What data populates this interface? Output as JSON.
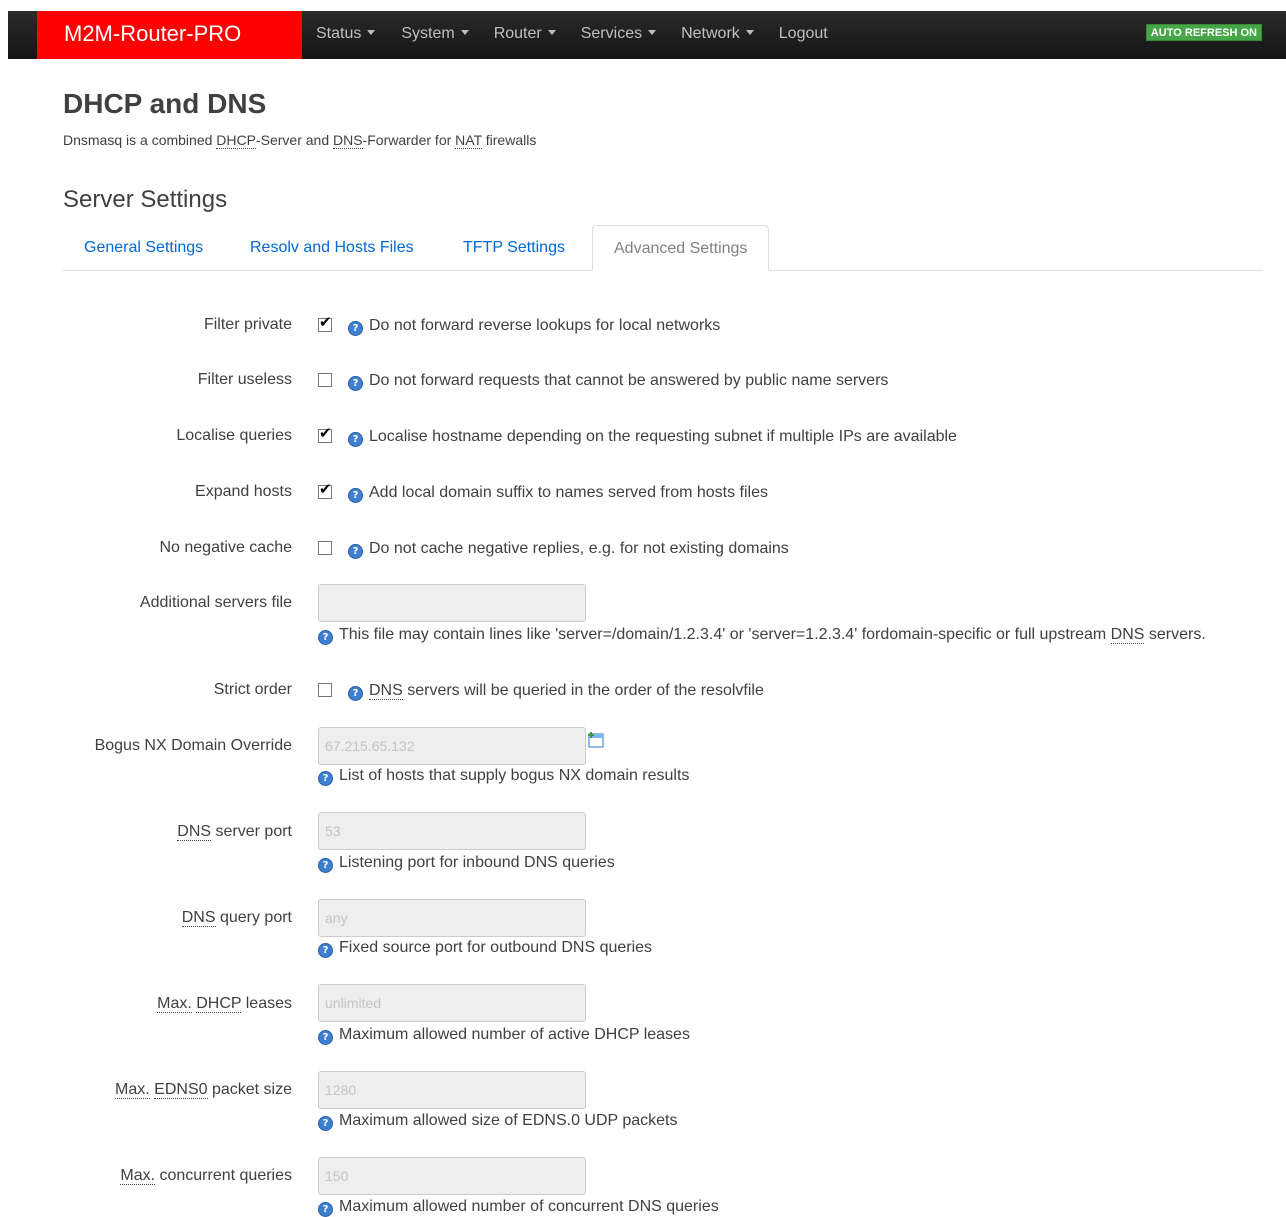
{
  "nav": {
    "brand": "M2M-Router-PRO",
    "menu": [
      {
        "label": "Status",
        "dropdown": true
      },
      {
        "label": "System",
        "dropdown": true
      },
      {
        "label": "Router",
        "dropdown": true
      },
      {
        "label": "Services",
        "dropdown": true
      },
      {
        "label": "Network",
        "dropdown": true
      },
      {
        "label": "Logout",
        "dropdown": false
      }
    ],
    "autorefresh": "AUTO REFRESH ON"
  },
  "page": {
    "title": "DHCP and DNS",
    "desc_parts": [
      "Dnsmasq is a combined ",
      "DHCP",
      "-Server and ",
      "DNS",
      "-Forwarder for ",
      "NAT",
      " firewalls"
    ]
  },
  "section": {
    "title": "Server Settings",
    "tabs": [
      "General Settings",
      "Resolv and Hosts Files",
      "TFTP Settings",
      "Advanced Settings"
    ],
    "active_tab": "Advanced Settings"
  },
  "fields": {
    "filter_private": {
      "label": "Filter private",
      "checked": true,
      "help": "Do not forward reverse lookups for local networks"
    },
    "filter_useless": {
      "label": "Filter useless",
      "checked": false,
      "help": "Do not forward requests that cannot be answered by public name servers"
    },
    "localise_queries": {
      "label": "Localise queries",
      "checked": true,
      "help": "Localise hostname depending on the requesting subnet if multiple IPs are available"
    },
    "expand_hosts": {
      "label": "Expand hosts",
      "checked": true,
      "help": "Add local domain suffix to names served from hosts files"
    },
    "no_negative_cache": {
      "label": "No negative cache",
      "checked": false,
      "help": "Do not cache negative replies, e.g. for not existing domains"
    },
    "additional_servers_file": {
      "label": "Additional servers file",
      "value": "",
      "placeholder": "",
      "help_parts": [
        "This file may contain lines like 'server=/domain/1.2.3.4' or 'server=1.2.3.4' fordomain-specific or full upstream ",
        "DNS",
        " servers."
      ]
    },
    "strict_order": {
      "label": "Strict order",
      "checked": false,
      "help_parts": [
        "DNS",
        " servers will be queried in the order of the resolvfile"
      ]
    },
    "bogus_nx": {
      "label": "Bogus NX Domain Override",
      "placeholder": "67.215.65.132",
      "help": "List of hosts that supply bogus NX domain results"
    },
    "dns_server_port": {
      "label_parts": [
        "DNS",
        " server port"
      ],
      "placeholder": "53",
      "help": "Listening port for inbound DNS queries"
    },
    "dns_query_port": {
      "label_parts": [
        "DNS",
        " query port"
      ],
      "placeholder": "any",
      "help": "Fixed source port for outbound DNS queries"
    },
    "max_dhcp_leases": {
      "label_parts": [
        "Max.",
        " ",
        "DHCP",
        " leases"
      ],
      "placeholder": "unlimited",
      "help": "Maximum allowed number of active DHCP leases"
    },
    "max_edns0": {
      "label_parts": [
        "Max.",
        " ",
        "EDNS0",
        " packet size"
      ],
      "placeholder": "1280",
      "help": "Maximum allowed size of EDNS.0 UDP packets"
    },
    "max_concurrent": {
      "label_parts": [
        "Max.",
        " concurrent queries"
      ],
      "placeholder": "150",
      "help": "Maximum allowed number of concurrent DNS queries"
    }
  },
  "icons": {
    "help": "help-icon",
    "add": "add-entry-icon"
  },
  "colors": {
    "brand": "#ff0000",
    "navbar": "#1f1f1f",
    "link": "#0069d6",
    "autorefresh": "#46a546"
  }
}
